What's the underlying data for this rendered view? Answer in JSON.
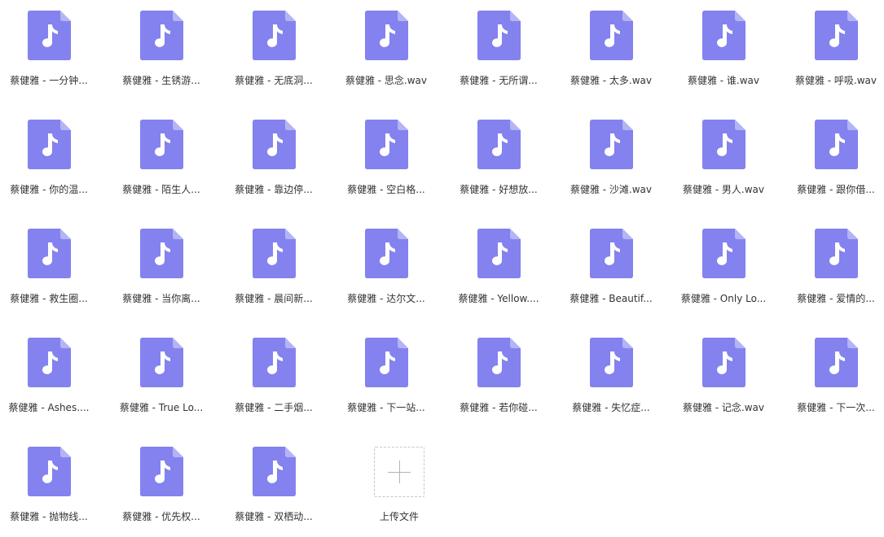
{
  "files": [
    {
      "name": "蔡健雅 - 一分钟..."
    },
    {
      "name": "蔡健雅 - 生锈游..."
    },
    {
      "name": "蔡健雅 - 无底洞..."
    },
    {
      "name": "蔡健雅 - 思念.wav"
    },
    {
      "name": "蔡健雅 - 无所谓..."
    },
    {
      "name": "蔡健雅 - 太多.wav"
    },
    {
      "name": "蔡健雅 - 谁.wav"
    },
    {
      "name": "蔡健雅 - 呼吸.wav"
    },
    {
      "name": "蔡健雅 - 你的温..."
    },
    {
      "name": "蔡健雅 - 陌生人..."
    },
    {
      "name": "蔡健雅 - 靠边停..."
    },
    {
      "name": "蔡健雅 - 空白格..."
    },
    {
      "name": "蔡健雅 - 好想放..."
    },
    {
      "name": "蔡健雅 - 沙滩.wav"
    },
    {
      "name": "蔡健雅 - 男人.wav"
    },
    {
      "name": "蔡健雅 - 跟你借..."
    },
    {
      "name": "蔡健雅 - 救生圈..."
    },
    {
      "name": "蔡健雅 - 当你离..."
    },
    {
      "name": "蔡健雅 - 晨间新..."
    },
    {
      "name": "蔡健雅 - 达尔文..."
    },
    {
      "name": "蔡健雅 - Yellow...."
    },
    {
      "name": "蔡健雅 - Beautif..."
    },
    {
      "name": "蔡健雅 - Only Lo..."
    },
    {
      "name": "蔡健雅 - 爱情的..."
    },
    {
      "name": "蔡健雅 - Ashes...."
    },
    {
      "name": "蔡健雅 - True Lo..."
    },
    {
      "name": "蔡健雅 - 二手烟..."
    },
    {
      "name": "蔡健雅 - 下一站..."
    },
    {
      "name": "蔡健雅 - 若你碰..."
    },
    {
      "name": "蔡健雅 - 失忆症..."
    },
    {
      "name": "蔡健雅 - 记念.wav"
    },
    {
      "name": "蔡健雅 - 下一次..."
    },
    {
      "name": "蔡健雅 - 抛物线..."
    },
    {
      "name": "蔡健雅 - 优先权..."
    },
    {
      "name": "蔡健雅 - 双栖动..."
    }
  ],
  "upload": {
    "label": "上传文件"
  },
  "colors": {
    "file_icon": "#8382ee",
    "file_icon_fold": "#b4b3f6",
    "file_icon_glyph": "#ffffff",
    "label_text": "#333333",
    "upload_border": "#c8c8c8",
    "upload_plus": "#b4b4b4"
  },
  "icons": {
    "file": "music-file-icon",
    "upload": "plus-icon"
  }
}
